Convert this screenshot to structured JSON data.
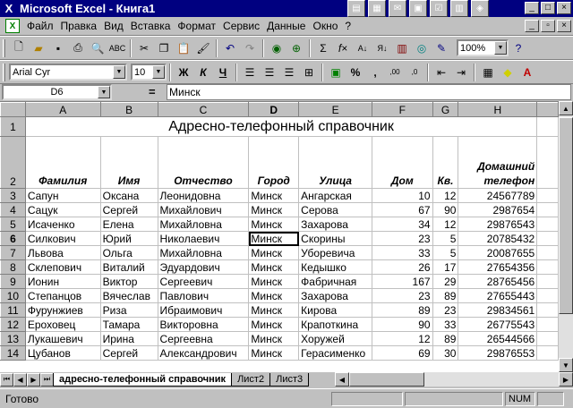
{
  "window": {
    "title": "Microsoft Excel - Книга1"
  },
  "menu": [
    "Файл",
    "Правка",
    "Вид",
    "Вставка",
    "Формат",
    "Сервис",
    "Данные",
    "Окно",
    "?"
  ],
  "toolbar": {
    "zoom": "100%",
    "sum_label": "Σ",
    "fx_label": "f×"
  },
  "format": {
    "font": "Arial Cyr",
    "size": "10",
    "bold": "Ж",
    "italic": "К",
    "underline": "Ч",
    "percent": "%",
    "comma": ","
  },
  "formula_bar": {
    "cell": "D6",
    "equals": "=",
    "value": "Минск"
  },
  "columns": [
    "A",
    "B",
    "C",
    "D",
    "E",
    "F",
    "G",
    "H"
  ],
  "sheet": {
    "title": "Адресно-телефонный справочник",
    "headers": [
      "Фамилия",
      "Имя",
      "Отчество",
      "Город",
      "Улица",
      "Дом",
      "Кв.",
      "Домашний телефон"
    ],
    "rows": [
      [
        "Сапун",
        "Оксана",
        "Леонидовна",
        "Минск",
        "Ангарская",
        "10",
        "12",
        "24567789"
      ],
      [
        "Сацук",
        "Сергей",
        "Михайлович",
        "Минск",
        "Серова",
        "67",
        "90",
        "2987654"
      ],
      [
        "Исаченко",
        "Елена",
        "Михайловна",
        "Минск",
        "Захарова",
        "34",
        "12",
        "29876543"
      ],
      [
        "Силкович",
        "Юрий",
        "Николаевич",
        "Минск",
        "Скорины",
        "23",
        "5",
        "20785432"
      ],
      [
        "Львова",
        "Ольга",
        "Михайловна",
        "Минск",
        "Уборевича",
        "33",
        "5",
        "20087655"
      ],
      [
        "Склепович",
        "Виталий",
        "Эдуардович",
        "Минск",
        "Кедышко",
        "26",
        "17",
        "27654356"
      ],
      [
        "Ионин",
        "Виктор",
        "Сергеевич",
        "Минск",
        "Фабричная",
        "167",
        "29",
        "28765456"
      ],
      [
        "Степанцов",
        "Вячеслав",
        "Павлович",
        "Минск",
        "Захарова",
        "23",
        "89",
        "27655443"
      ],
      [
        "Фурунжиев",
        "Риза",
        "Ибраимович",
        "Минск",
        "Кирова",
        "89",
        "23",
        "29834561"
      ],
      [
        "Ероховец",
        "Тамара",
        "Викторовна",
        "Минск",
        "Крапоткина",
        "90",
        "33",
        "26775543"
      ],
      [
        "Лукашевич",
        "Ирина",
        "Сергеевна",
        "Минск",
        "Хоружей",
        "12",
        "89",
        "26544566"
      ],
      [
        "Цубанов",
        "Сергей",
        "Александрович",
        "Минск",
        "Герасименко",
        "69",
        "30",
        "29876553"
      ]
    ]
  },
  "tabs": [
    "адресно-телефонный справочник",
    "Лист2",
    "Лист3"
  ],
  "status": {
    "text": "Готово",
    "num": "NUM"
  }
}
